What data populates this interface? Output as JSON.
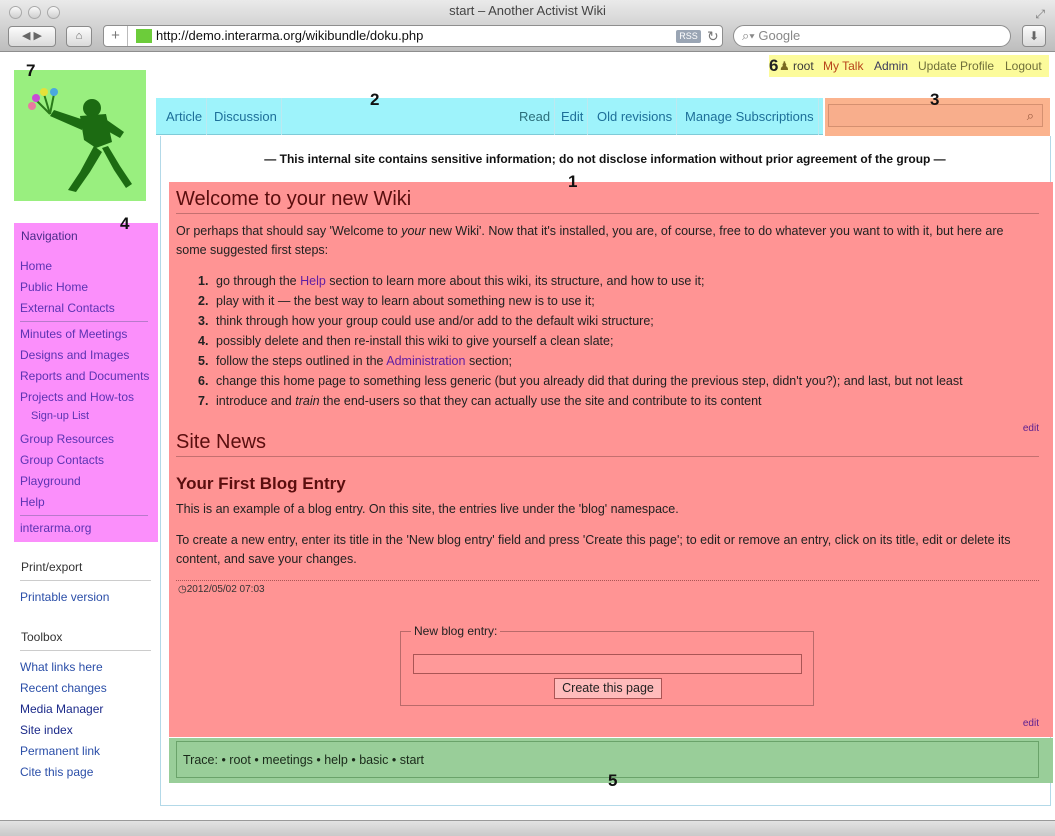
{
  "window": {
    "title": "start – Another Activist Wiki",
    "url": "http://demo.interarma.org/wikibundle/doku.php",
    "rss": "RSS",
    "search_placeholder": "Google"
  },
  "markers": [
    "1",
    "2",
    "3",
    "4",
    "5",
    "6",
    "7"
  ],
  "user": {
    "name": "root",
    "links": [
      "My Talk",
      "Admin",
      "Update Profile",
      "Logout"
    ]
  },
  "tabs_left": [
    "Article",
    "Discussion"
  ],
  "tabs_right": [
    "Read",
    "Edit",
    "Old revisions",
    "Manage Subscriptions"
  ],
  "notice": "— This internal site contains sensitive information; do not disclose information without prior agreement of the group —",
  "navigation": {
    "heading": "Navigation",
    "items": [
      "Home",
      "Public Home",
      "External Contacts",
      "Minutes of Meetings",
      "Designs and Images",
      "Reports and Documents",
      "Projects and How-tos",
      "Sign-up List",
      "Group Resources",
      "Group Contacts",
      "Playground",
      "Help",
      "interarma.org"
    ]
  },
  "print": {
    "heading": "Print/export",
    "items": [
      "Printable version"
    ]
  },
  "toolbox": {
    "heading": "Toolbox",
    "items": [
      "What links here",
      "Recent changes",
      "Media Manager",
      "Site index",
      "Permanent link",
      "Cite this page"
    ]
  },
  "main": {
    "title": "Welcome to your new Wiki",
    "intro_a": "Or perhaps that should say 'Welcome to ",
    "intro_em": "your",
    "intro_b": " new Wiki'. Now that it's installed, you are, of course, free to do whatever you want to with it, but here are some suggested first steps:",
    "steps": [
      {
        "n": "1.",
        "a": "go through the ",
        "link": "Help",
        "b": " section to learn more about this wiki, its structure, and how to use it;"
      },
      {
        "n": "2.",
        "a": "play with it — the best way to learn about something new is to use it;",
        "link": "",
        "b": ""
      },
      {
        "n": "3.",
        "a": "think through how your group could use and/or add to the default wiki structure;",
        "link": "",
        "b": ""
      },
      {
        "n": "4.",
        "a": "possibly delete and then re-install this wiki to give yourself a clean slate;",
        "link": "",
        "b": ""
      },
      {
        "n": "5.",
        "a": "follow the steps outlined in the ",
        "link": "Administration",
        "b": " section;"
      },
      {
        "n": "6.",
        "a": "change this home page to something less generic (but you already did that during the previous step, didn't you?); and last, but not least",
        "link": "",
        "b": ""
      },
      {
        "n": "7.",
        "a": "introduce and ",
        "em": "train",
        "b": " the end-users so that they can actually use the site and contribute to its content"
      }
    ],
    "edit": "edit",
    "news_title": "Site News",
    "blog_title": "Your First Blog Entry",
    "blog_p1": "This is an example of a blog entry. On this site, the entries live under the 'blog' namespace.",
    "blog_p2": "To create a new entry, enter its title in the 'New blog entry' field and press 'Create this page'; to edit or remove an entry, click on its title, edit or delete its content, and save your changes.",
    "date": "2012/05/02 07:03",
    "form_legend": "New blog entry:",
    "form_button": "Create this page"
  },
  "trace": {
    "label": "Trace:",
    "items": [
      "root",
      "meetings",
      "help",
      "basic",
      "start"
    ]
  },
  "colors": {
    "content": "#ff9494",
    "tabs": "#9ef3fb",
    "search": "#fbb38e",
    "nav": "#fb8ffb",
    "trace": "#99ce99",
    "user": "#fcfb9b",
    "logo": "#99ef7f"
  }
}
